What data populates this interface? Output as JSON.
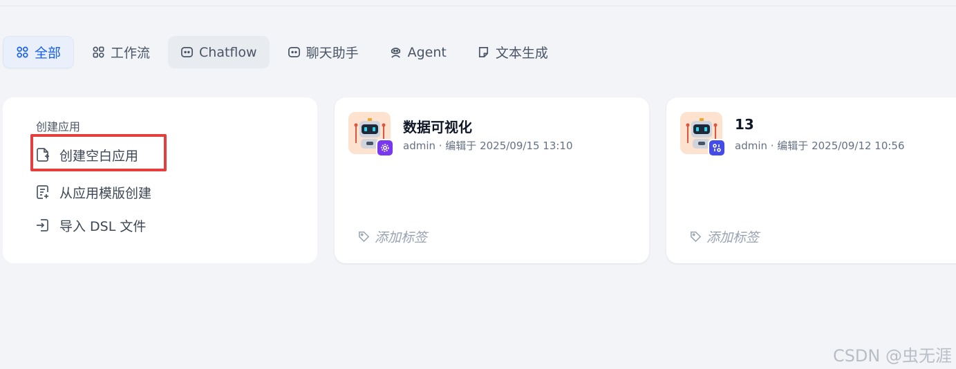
{
  "tabs": [
    {
      "label": "全部",
      "icon": "grid-icon",
      "active": true
    },
    {
      "label": "工作流",
      "icon": "workflow-icon"
    },
    {
      "label": "Chatflow",
      "icon": "chatflow-icon"
    },
    {
      "label": "聊天助手",
      "icon": "chat-bot-icon"
    },
    {
      "label": "Agent",
      "icon": "agent-icon"
    },
    {
      "label": "文本生成",
      "icon": "text-doc-icon"
    }
  ],
  "create": {
    "title": "创建应用",
    "items": [
      {
        "label": "创建空白应用",
        "icon": "new-file-icon"
      },
      {
        "label": "从应用模版创建",
        "icon": "template-file-icon"
      },
      {
        "label": "导入 DSL 文件",
        "icon": "import-icon"
      }
    ]
  },
  "apps": [
    {
      "name": "数据可视化",
      "meta": "admin · 编辑于 2025/09/15 13:10",
      "tag_placeholder": "添加标签",
      "badge_color": "#7839ee"
    },
    {
      "name": "13",
      "meta": "admin · 编辑于 2025/09/12 10:56",
      "tag_placeholder": "添加标签",
      "badge_color": "#444ce7"
    }
  ],
  "colors": {
    "accent": "#155eef",
    "highlight": "#e53e3e",
    "avatar_bg": "#fde3cf"
  },
  "watermark": "CSDN @虫无涯"
}
